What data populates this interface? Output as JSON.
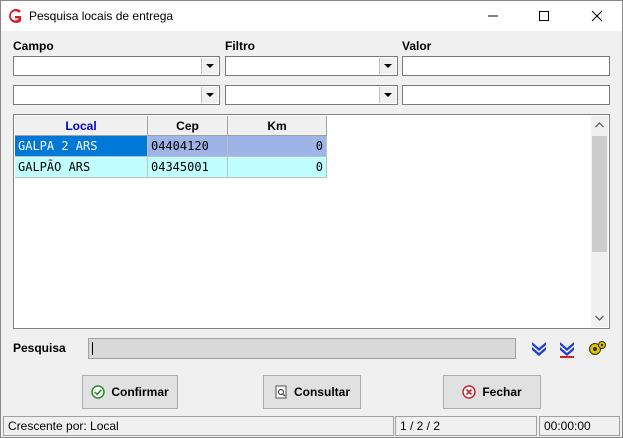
{
  "window": {
    "title": "Pesquisa locais de entrega"
  },
  "filters": {
    "campo_label": "Campo",
    "filtro_label": "Filtro",
    "valor_label": "Valor",
    "rows": [
      {
        "campo": "",
        "filtro": "",
        "valor": ""
      },
      {
        "campo": "",
        "filtro": "",
        "valor": ""
      }
    ]
  },
  "grid": {
    "columns": [
      "Local",
      "Cep",
      "Km"
    ],
    "rows": [
      {
        "local": "GALPA 2 ARS",
        "cep": "04404120",
        "km": "0",
        "selected": true
      },
      {
        "local": "GALPÃO ARS",
        "cep": "04345001",
        "km": "0",
        "selected": false
      }
    ]
  },
  "search": {
    "label": "Pesquisa",
    "value": ""
  },
  "buttons": {
    "confirm": "Confirmar",
    "consult": "Consultar",
    "close": "Fechar"
  },
  "status": {
    "sort": "Crescente por: Local",
    "position": "1 / 2 / 2",
    "time": "00:00:00"
  },
  "colors": {
    "header_local": "#0000cc",
    "row_selected_local": "#0078d7",
    "row_selected_cells": "#9eb3e6",
    "row_cyan": "#c0ffff"
  }
}
